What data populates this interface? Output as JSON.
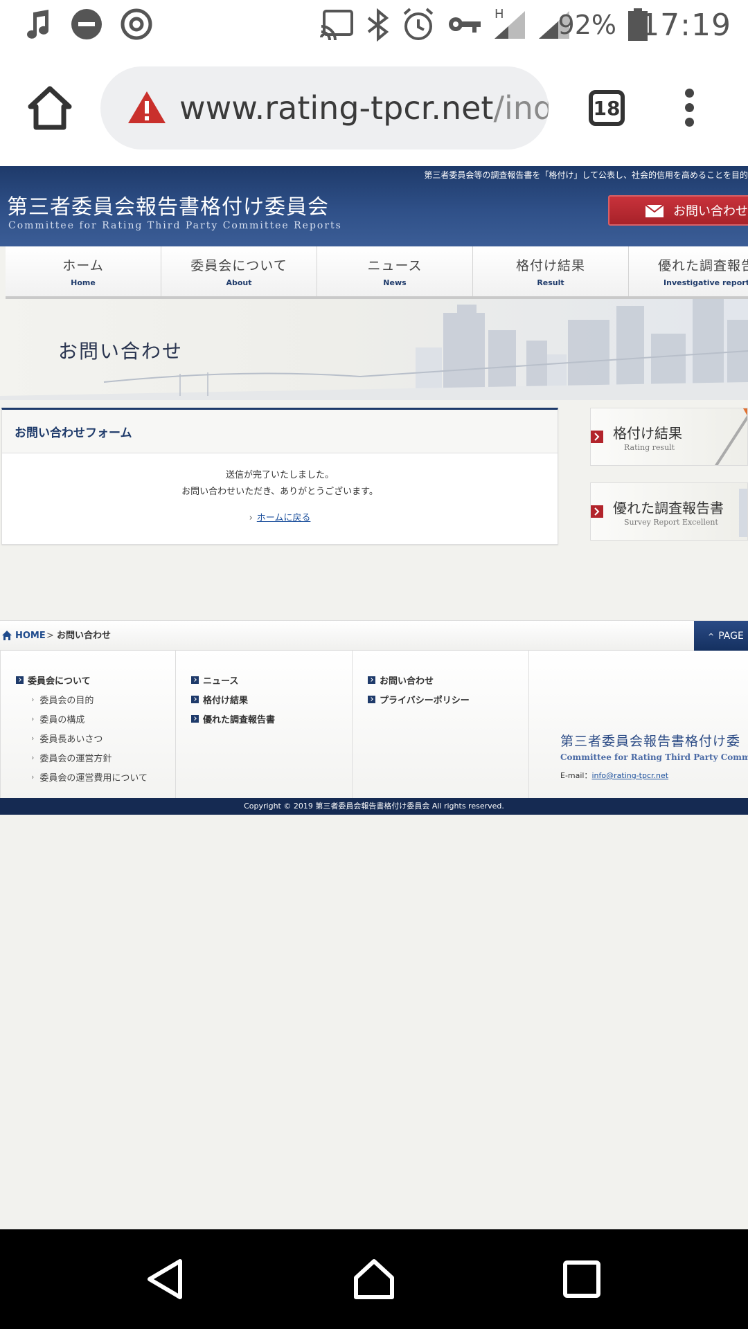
{
  "status_bar": {
    "battery": "92%",
    "time": "17:19",
    "network_label": "H",
    "icons": [
      "music-note-icon",
      "do-not-disturb-icon",
      "at-sign-icon",
      "cast-icon",
      "bluetooth-icon",
      "alarm-icon",
      "vpn-key-icon",
      "signal-icon",
      "signal-icon",
      "battery-icon"
    ]
  },
  "browser": {
    "url_host": "www.rating-tpcr.net",
    "url_path": "/inq",
    "tab_count": "18",
    "icons": [
      "home-icon",
      "warning-icon",
      "menu-icon"
    ]
  },
  "header": {
    "tagline": "第三者委員会等の調査報告書を「格付け」して公表し、社会的信用を高めることを目的",
    "logo_jp": "第三者委員会報告書格付け委員会",
    "logo_en": "Committee for Rating Third Party Committee Reports",
    "contact_label": "お問い合わせ"
  },
  "nav": {
    "items": [
      {
        "jp": "ホーム",
        "en": "Home"
      },
      {
        "jp": "委員会について",
        "en": "About"
      },
      {
        "jp": "ニュース",
        "en": "News"
      },
      {
        "jp": "格付け結果",
        "en": "Result"
      },
      {
        "jp": "優れた調査報告",
        "en": "Investigative report"
      }
    ]
  },
  "hero": {
    "title": "お問い合わせ"
  },
  "form": {
    "heading": "お問い合わせフォーム",
    "message_line1": "送信が完了いたしました。",
    "message_line2": "お問い合わせいただき、ありがとうございます。",
    "back_link": "ホームに戻る"
  },
  "side": {
    "banner1": {
      "title": "格付け結果",
      "subtitle": "Rating result"
    },
    "banner2": {
      "title": "優れた調査報告書",
      "subtitle": "Survey Report Excellent"
    }
  },
  "breadcrumb": {
    "home": "HOME",
    "separator": ">",
    "current": "お問い合わせ",
    "page_top": "PAGE"
  },
  "footer": {
    "col1": {
      "heading": "委員会について",
      "items": [
        "委員会の目的",
        "委員の構成",
        "委員長あいさつ",
        "委員会の運営方針",
        "委員会の運営費用について"
      ]
    },
    "col2": {
      "items": [
        "ニュース",
        "格付け結果",
        "優れた調査報告書"
      ]
    },
    "col3": {
      "items": [
        "お問い合わせ",
        "プライバシーポリシー"
      ]
    },
    "logo_jp": "第三者委員会報告書格付け委",
    "logo_en": "Committee for Rating Third Party Committee",
    "email_label": "E-mail：",
    "email": "info@rating-tpcr.net"
  },
  "copyright": "Copyright © 2019 第三者委員会報告書格付け委員会 All rights reserved.",
  "colors": {
    "navy": "#1e3a6a",
    "accent_red": "#b2242b",
    "warning_red": "#c9302c",
    "footer_bar": "#152a52"
  }
}
